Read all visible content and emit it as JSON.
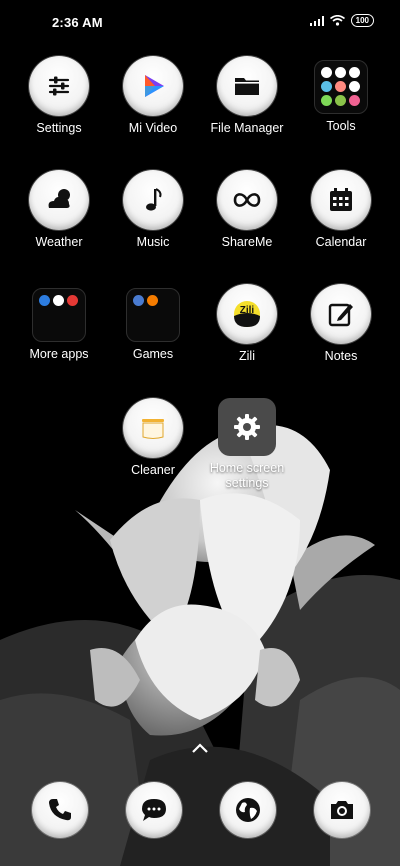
{
  "status_bar": {
    "time": "2:36 AM",
    "battery": "100"
  },
  "apps": [
    {
      "name": "Settings",
      "icon": "sliders-icon"
    },
    {
      "name": "Mi Video",
      "icon": "play-icon"
    },
    {
      "name": "File Manager",
      "icon": "folder-icon"
    },
    {
      "name": "Tools",
      "icon": "tools-folder-icon"
    },
    {
      "name": "Weather",
      "icon": "cloud-sun-icon"
    },
    {
      "name": "Music",
      "icon": "music-note-icon"
    },
    {
      "name": "ShareMe",
      "icon": "infinity-icon"
    },
    {
      "name": "Calendar",
      "icon": "calendar-icon"
    },
    {
      "name": "More apps",
      "icon": "apps-folder-icon"
    },
    {
      "name": "Games",
      "icon": "games-folder-icon"
    },
    {
      "name": "Zili",
      "icon": "zili-icon"
    },
    {
      "name": "Notes",
      "icon": "note-edit-icon"
    },
    {
      "name": "Cleaner",
      "icon": "cleaner-icon"
    }
  ],
  "home_settings": {
    "label": "Home screen settings",
    "icon": "gear-icon"
  },
  "dock": [
    {
      "name": "Phone",
      "icon": "phone-icon"
    },
    {
      "name": "Messaging",
      "icon": "message-icon"
    },
    {
      "name": "Browser",
      "icon": "globe-icon"
    },
    {
      "name": "Camera",
      "icon": "camera-icon"
    }
  ],
  "colors": {
    "background": "#000000",
    "icon_face": "#f4f4f4",
    "zili_yellow": "#f5df2c"
  }
}
